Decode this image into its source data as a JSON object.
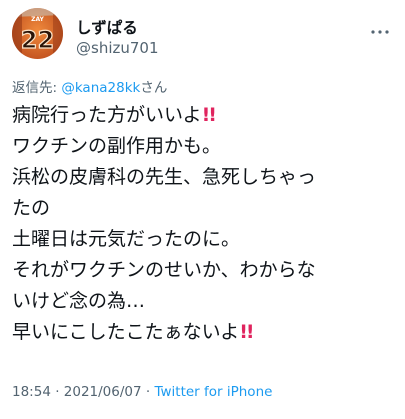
{
  "author": {
    "display_name": "しずぱる",
    "handle": "@shizu701",
    "avatar_icon": "jersey-22-avatar",
    "avatar_number": "22",
    "avatar_lettering": "ZAY"
  },
  "reply": {
    "prefix": "返信先: ",
    "handle": "@kana28kk",
    "suffix": "さん"
  },
  "tweet": {
    "lines": [
      {
        "text": "病院行った方がいいよ",
        "bang": "!!"
      },
      {
        "text": "ワクチンの副作用かも。",
        "bang": ""
      },
      {
        "text": "浜松の皮膚科の先生、急死しちゃっ",
        "bang": ""
      },
      {
        "text": "たの",
        "bang": ""
      },
      {
        "text": "土曜日は元気だったのに。",
        "bang": ""
      },
      {
        "text": "それがワクチンのせいか、わからな",
        "bang": ""
      },
      {
        "text": "いけど念の為…",
        "bang": ""
      },
      {
        "text": "早いにこしたこたぁないよ",
        "bang": "!!"
      }
    ]
  },
  "meta": {
    "time": "18:54",
    "separator": " · ",
    "date": "2021/06/07",
    "source": "Twitter for iPhone"
  },
  "colors": {
    "accent": "#1d9bf0",
    "secondary_text": "#536471",
    "primary_text": "#0f1419",
    "bang": "#e0245e",
    "jersey": "#e8671c"
  }
}
